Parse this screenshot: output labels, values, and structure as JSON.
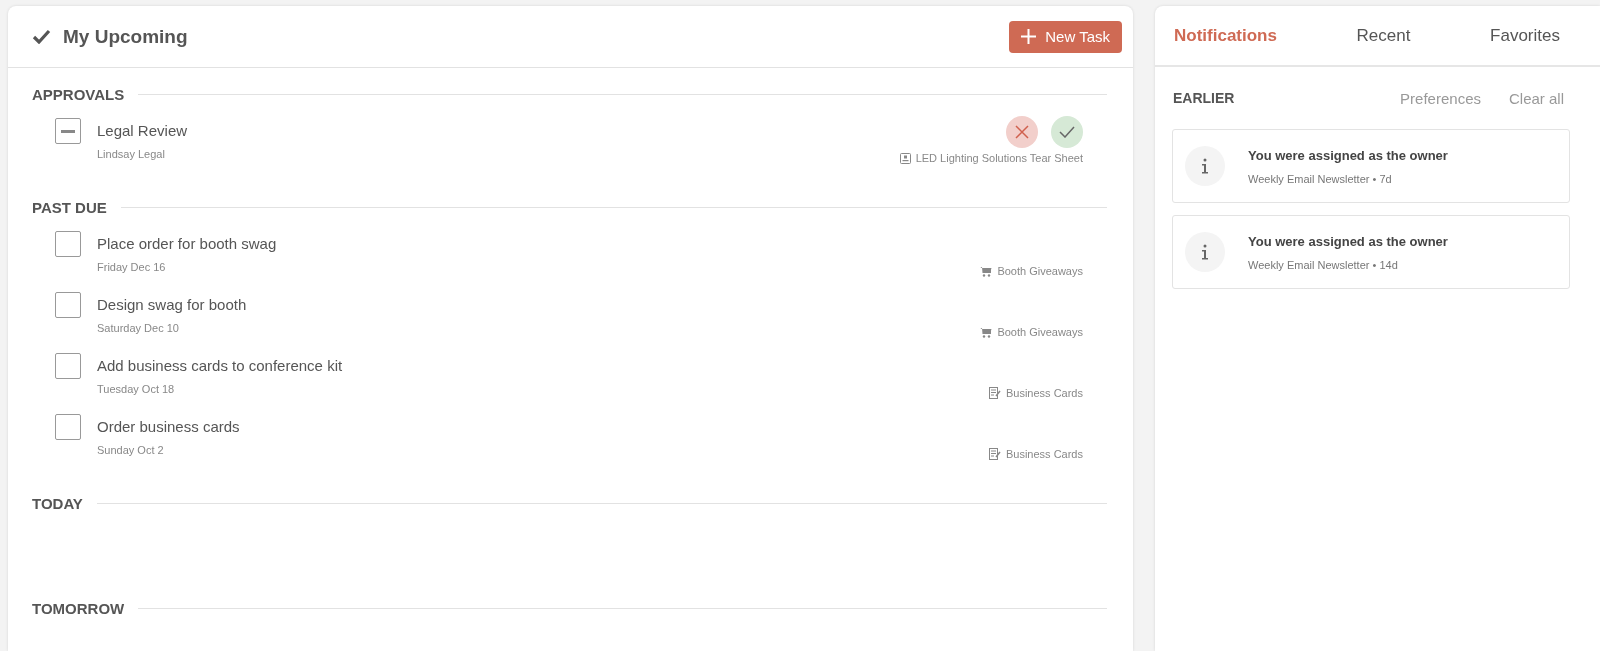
{
  "header": {
    "title": "My Upcoming",
    "new_task_button": "New Task"
  },
  "sections": [
    {
      "title": "APPROVALS",
      "tasks": [
        {
          "kind": "approval",
          "title": "Legal Review",
          "subtitle": "Lindsay Legal",
          "project": {
            "label": "LED Lighting Solutions Tear Sheet",
            "kind": "document"
          },
          "indeterminate": true
        }
      ]
    },
    {
      "title": "PAST DUE",
      "tasks": [
        {
          "kind": "task",
          "title": "Place order for booth swag",
          "subtitle": "Friday Dec 16",
          "project": {
            "label": "Booth Giveaways",
            "kind": "cart"
          },
          "checked": false
        },
        {
          "kind": "task",
          "title": "Design swag for booth",
          "subtitle": "Saturday Dec 10",
          "project": {
            "label": "Booth Giveaways",
            "kind": "cart"
          },
          "checked": false
        },
        {
          "kind": "task",
          "title": "Add business cards to conference kit",
          "subtitle": "Tuesday Oct 18",
          "project": {
            "label": "Business Cards",
            "kind": "notes"
          },
          "checked": false
        },
        {
          "kind": "task",
          "title": "Order business cards",
          "subtitle": "Sunday Oct 2",
          "project": {
            "label": "Business Cards",
            "kind": "notes"
          },
          "checked": false
        }
      ]
    },
    {
      "title": "TODAY"
    },
    {
      "title": "TOMORROW"
    }
  ],
  "side_tabs": [
    {
      "label": "Notifications",
      "selected": true
    },
    {
      "label": "Recent",
      "selected": false
    },
    {
      "label": "Favorites",
      "selected": false
    }
  ],
  "notifications": {
    "heading": "EARLIER",
    "preferences_link": "Preferences",
    "clear_all_link": "Clear all",
    "items": [
      {
        "title": "You were assigned as the owner",
        "detail": "Weekly Email Newsletter • 7d"
      },
      {
        "title": "You were assigned as the owner",
        "detail": "Weekly Email Newsletter • 14d"
      }
    ]
  }
}
